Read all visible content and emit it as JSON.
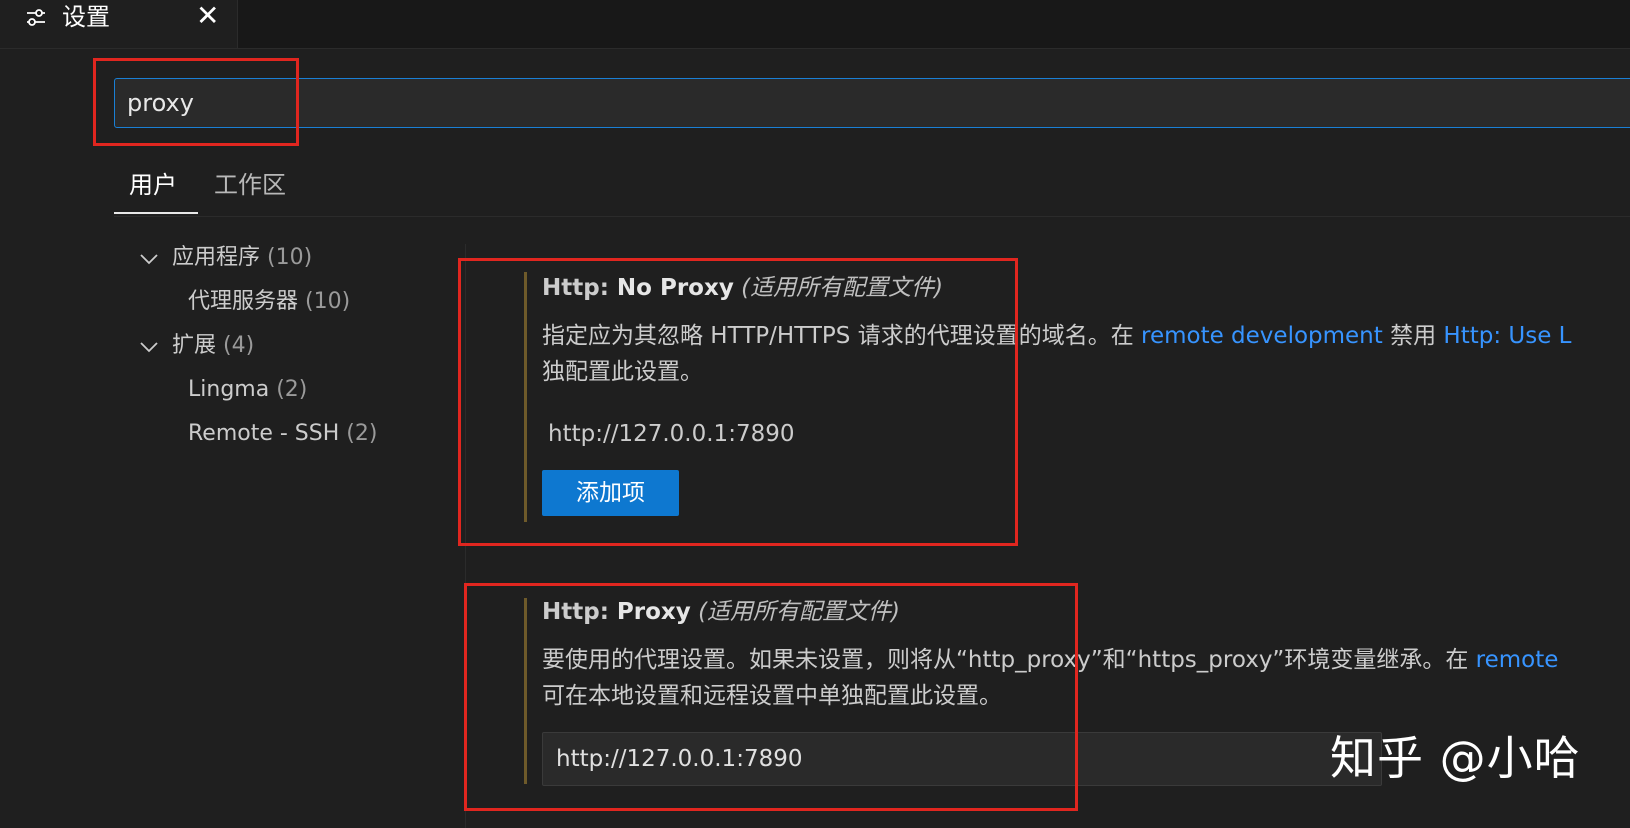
{
  "tab": {
    "title": "设置",
    "icon": "settings-sliders-icon",
    "close_glyph": "✕"
  },
  "search": {
    "value": "proxy"
  },
  "scope_tabs": {
    "user": "用户",
    "workspace": "工作区"
  },
  "toc": {
    "items": [
      {
        "label": "应用程序",
        "count": "(10)"
      },
      {
        "label": "代理服务器",
        "count": "(10)"
      },
      {
        "label": "扩展",
        "count": "(4)"
      },
      {
        "label": "Lingma",
        "count": "(2)"
      },
      {
        "label": "Remote - SSH",
        "count": "(2)"
      }
    ]
  },
  "settings": [
    {
      "category": "Http: ",
      "name": "No Proxy",
      "scope": "(适用所有配置文件)",
      "desc_line1_a": "指定应为其忽略 HTTP/HTTPS 请求的代理设置的域名。在 ",
      "desc_link1": "remote development",
      "desc_line1_b": " 禁用 ",
      "desc_link2": "Http: Use L",
      "desc_line2": "独配置此设置。",
      "list_value": "http://127.0.0.1:7890",
      "button_label": "添加项"
    },
    {
      "category": "Http: ",
      "name": "Proxy",
      "scope": "(适用所有配置文件)",
      "desc_line1_a": "要使用的代理设置。如果未设置，则将从“http_proxy”和“https_proxy”环境变量继承。在 ",
      "desc_link1": "remote",
      "desc_line2": "可在本地设置和远程设置中单独配置此设置。",
      "value": "http://127.0.0.1:7890"
    }
  ],
  "watermark": "知乎 @小哈",
  "colors": {
    "background": "#1f1f1f",
    "accent": "#1a7fd4",
    "link": "#3794ff",
    "button": "#0e78d0",
    "highlight": "#e0261f"
  }
}
